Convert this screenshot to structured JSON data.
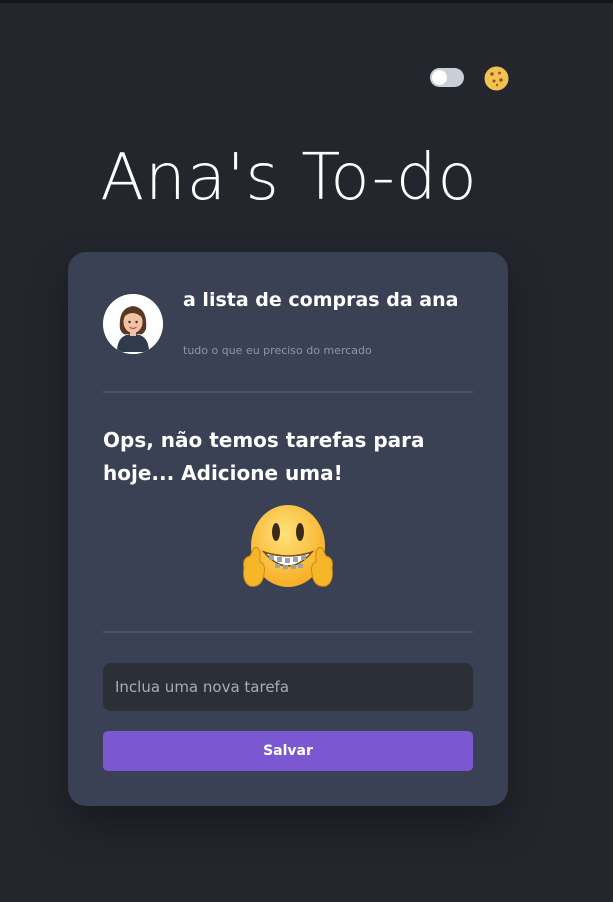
{
  "header": {
    "title": "Ana's To-do",
    "theme_toggle": {
      "state": "off"
    },
    "theme_icon": "cookie-icon"
  },
  "card": {
    "avatar_icon": "avatar-woman-icon",
    "list_title": "a lista de compras da ana",
    "list_subtitle": "tudo o que eu preciso do mercado",
    "empty_message": "Ops, não temos tarefas para hoje... Adicione uma!",
    "empty_emoji": "grinning-braces-thumbs-up-icon",
    "input": {
      "placeholder": "Inclua uma nova tarefa",
      "value": ""
    },
    "save_label": "Salvar"
  },
  "colors": {
    "background": "#23262d",
    "card": "#3a4155",
    "accent": "#7b57d1",
    "input": "#2b2f38"
  }
}
